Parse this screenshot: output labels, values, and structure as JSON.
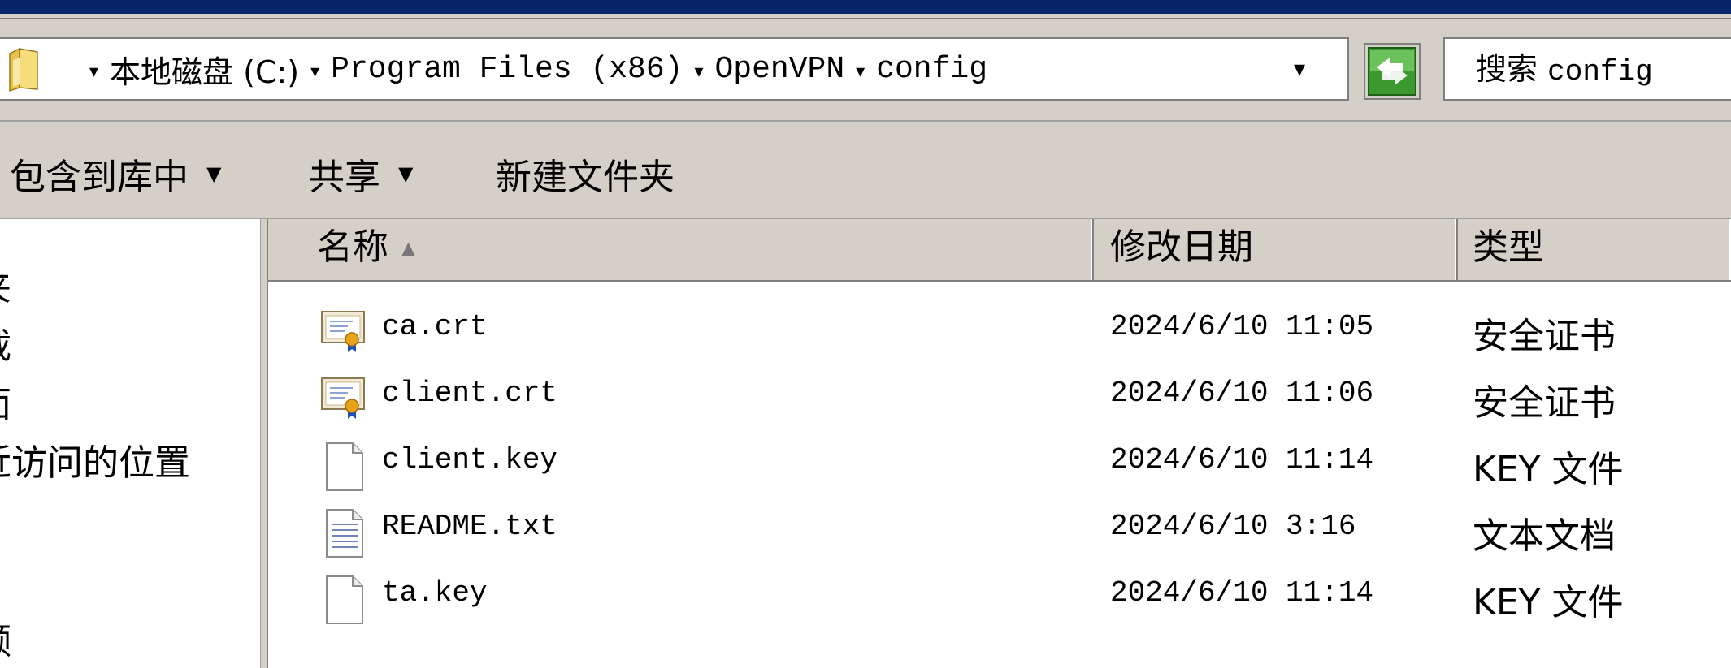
{
  "address_bar": {
    "breadcrumb": [
      "本地磁盘 (C:)",
      "Program Files (x86)",
      "OpenVPN",
      "config"
    ],
    "separator": "▾",
    "dropdown_glyph": "▾",
    "search_label": "搜索",
    "search_term": "config"
  },
  "toolbar": {
    "include_in_library": "包含到库中",
    "share": "共享",
    "new_folder": "新建文件夹",
    "dropdown_glyph": "▼"
  },
  "nav_pane": {
    "items": [
      "夹",
      "载",
      "面",
      "近访问的位置",
      "频"
    ]
  },
  "file_list": {
    "columns": {
      "name": "名称",
      "modified": "修改日期",
      "type": "类型"
    },
    "sort_glyph": "▲",
    "files": [
      {
        "name": "ca.crt",
        "modified": "2024/6/10 11:05",
        "type": "安全证书",
        "icon": "certificate-icon"
      },
      {
        "name": "client.crt",
        "modified": "2024/6/10 11:06",
        "type": "安全证书",
        "icon": "certificate-icon"
      },
      {
        "name": "client.key",
        "modified": "2024/6/10 11:14",
        "type": "KEY 文件",
        "icon": "blank-file-icon"
      },
      {
        "name": "README.txt",
        "modified": "2024/6/10 3:16",
        "type": "文本文档",
        "icon": "text-file-icon"
      },
      {
        "name": "ta.key",
        "modified": "2024/6/10 11:14",
        "type": "KEY 文件",
        "icon": "blank-file-icon"
      }
    ]
  },
  "colors": {
    "title_bar": "#0a246a",
    "chrome": "#d4d0c8",
    "certificate_ribbon": "#1b4fbf",
    "certificate_seal": "#e8a317"
  }
}
